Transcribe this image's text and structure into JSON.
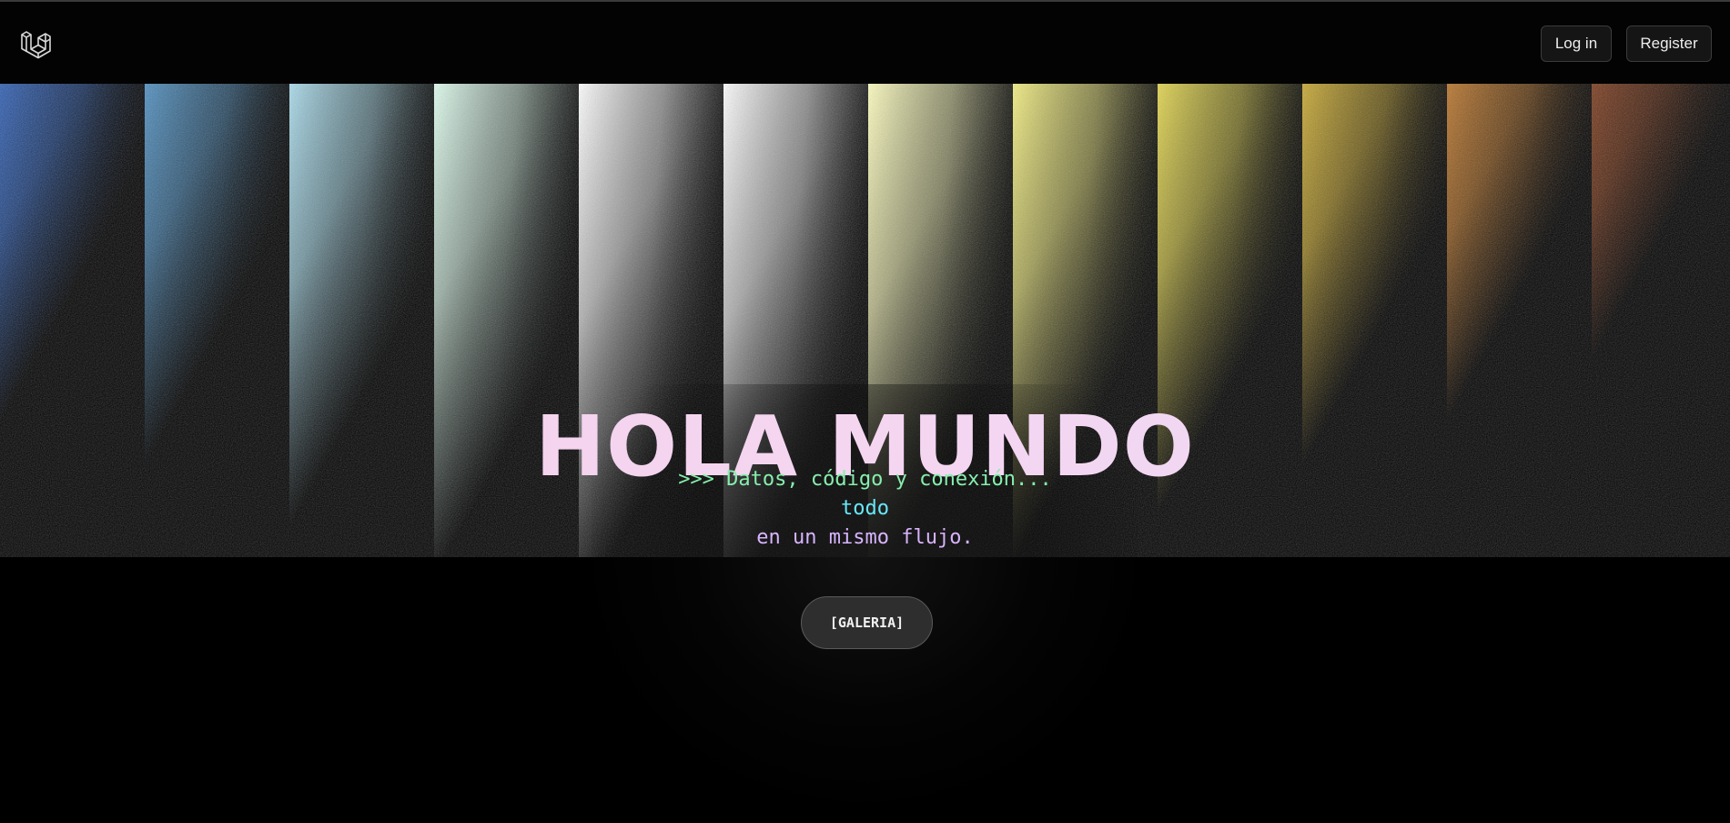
{
  "nav": {
    "logo_icon": "laravel-logo-icon",
    "login_label": "Log in",
    "register_label": "Register"
  },
  "hero": {
    "title": "HOLA MUNDO",
    "tagline_line1": ">>> Datos, código y conexión...",
    "tagline_line2": "todo",
    "tagline_line3": "en un mismo flujo.",
    "cta_label": "[GALERIA]"
  },
  "colors": {
    "background": "#000000",
    "tagline_green": "#86efac",
    "tagline_cyan": "#67e8f9",
    "tagline_purple": "#d8b4fe",
    "title_pink": "#f5d6f1",
    "stripe_colors": [
      "#2f5fb4",
      "#4f8fc0",
      "#a9dcec",
      "#e0fff0",
      "#ffffff",
      "#ffffff",
      "#ffffbf",
      "#f4ef80",
      "#e3d64e",
      "#c9a932",
      "#b9742a",
      "#7a3a1c"
    ]
  }
}
